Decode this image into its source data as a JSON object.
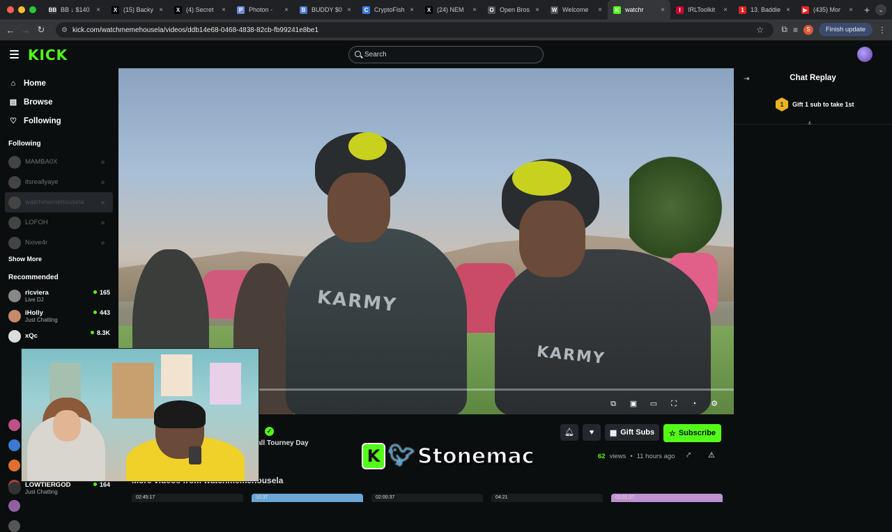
{
  "browser": {
    "tabs": [
      {
        "title": "BB ↓ $140",
        "favicon": "BB",
        "color": "#333"
      },
      {
        "title": "(15) Backy",
        "favicon": "X",
        "color": "#000"
      },
      {
        "title": "(4) Secret",
        "favicon": "X",
        "color": "#000"
      },
      {
        "title": "Photon - ",
        "favicon": "P",
        "color": "#6c8bd8"
      },
      {
        "title": "BUDDY $0",
        "favicon": "B",
        "color": "#4a7bd0"
      },
      {
        "title": "CryptoFish",
        "favicon": "C",
        "color": "#3b7bdd"
      },
      {
        "title": "(24) NEM",
        "favicon": "X",
        "color": "#000"
      },
      {
        "title": "Open Bros",
        "favicon": "O",
        "color": "#555"
      },
      {
        "title": "Welcome",
        "favicon": "W",
        "color": "#555"
      },
      {
        "title": "watchr",
        "favicon": "K",
        "color": "#53fc18",
        "active": true
      },
      {
        "title": "IRLToolkit",
        "favicon": "I",
        "color": "#c03"
      },
      {
        "title": "13. Baddie",
        "favicon": "1",
        "color": "#d22"
      },
      {
        "title": "(435) Mor",
        "favicon": "▶",
        "color": "#e22"
      }
    ],
    "url": "kick.com/watchmemehousela/videos/ddb14e68-0468-4838-82cb-fb99241e8be1",
    "finish_update": "Finish update",
    "profile_initial": "S"
  },
  "kick": {
    "logo": "KICK",
    "search_placeholder": "Search"
  },
  "sidebar": {
    "nav": [
      {
        "label": "Home",
        "icon": "home-icon"
      },
      {
        "label": "Browse",
        "icon": "browse-icon"
      },
      {
        "label": "Following",
        "icon": "heart-icon"
      }
    ],
    "following_title": "Following",
    "following": [
      {
        "name": "MAMBA0X"
      },
      {
        "name": "itsreallyaye"
      },
      {
        "name": "watchmemehousela",
        "selected": true
      },
      {
        "name": "LOFOH"
      },
      {
        "name": "Nxive4r"
      }
    ],
    "show_more": "Show More",
    "recommended_title": "Recommended",
    "recommended": [
      {
        "name": "ricviera",
        "category": "Live DJ",
        "viewers": "165",
        "color": "#888"
      },
      {
        "name": "iHolly",
        "category": "Just Chatting",
        "viewers": "443",
        "color": "#c58a6a"
      },
      {
        "name": "xQc",
        "category": "",
        "viewers": "8.3K",
        "color": "#ddd"
      }
    ],
    "bottom_rec": {
      "name": "LOWTIERGOD",
      "category": "Just Chatting",
      "viewers": "164"
    }
  },
  "video": {
    "jersey_text": "KARMY",
    "channel_name_fragment": "n",
    "subtitle_fragment": "all Tourney Day",
    "gift_subs": "Gift Subs",
    "subscribe": "Subscribe",
    "views_count": "62",
    "views_label": "views",
    "posted": "11 hours ago",
    "more_videos": "More videos from watchmemehousela",
    "thumb_times": [
      "02:45:17",
      "10:37",
      "02:00:37",
      "04:21",
      "02:01:37"
    ]
  },
  "chat": {
    "title": "Chat Replay",
    "gift_rank": "1",
    "gift_text": "Gift 1 sub to take 1st"
  },
  "overlay": {
    "brand_letter": "K",
    "brand_name": "Stonemac"
  }
}
